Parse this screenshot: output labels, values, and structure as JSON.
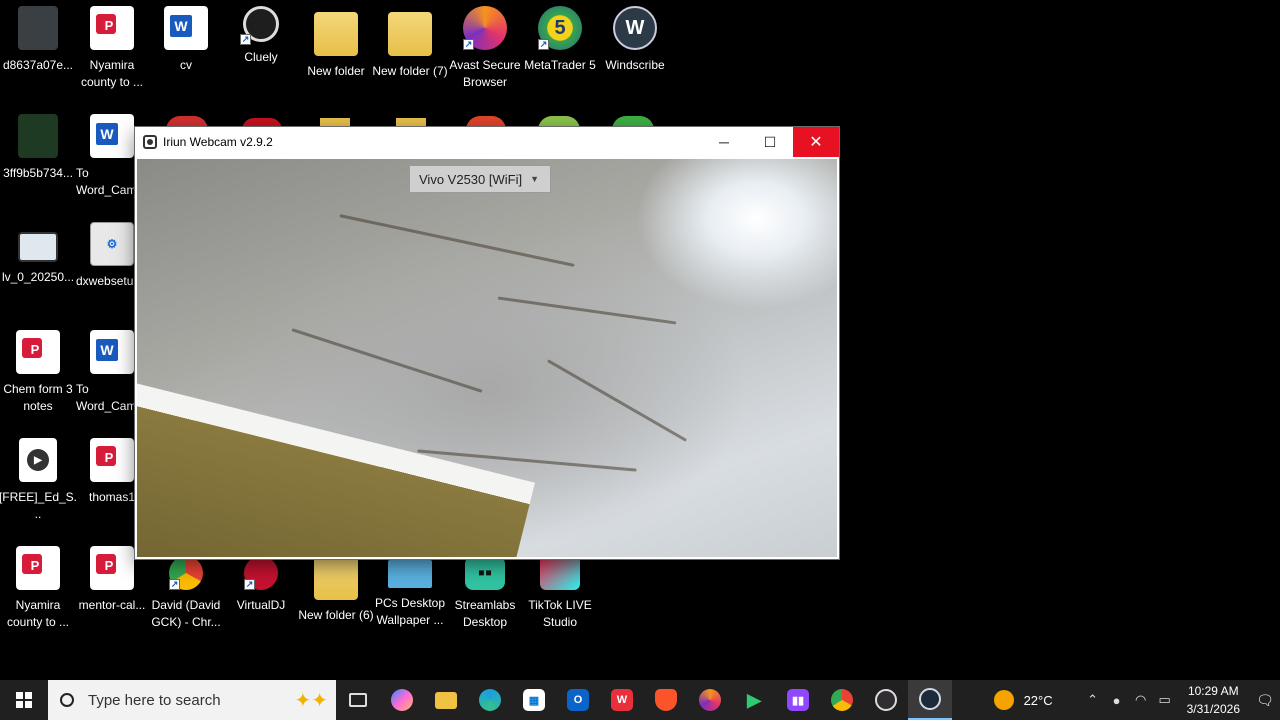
{
  "desktop": {
    "icons": [
      {
        "label": "d8637a07e...",
        "kind": "image"
      },
      {
        "label": "Nyamira county to ...",
        "kind": "pdf"
      },
      {
        "label": "cv",
        "kind": "word"
      },
      {
        "label": "Cluely",
        "kind": "app"
      },
      {
        "label": "New folder",
        "kind": "folder"
      },
      {
        "label": "New folder (7)",
        "kind": "folder"
      },
      {
        "label": "Avast Secure Browser",
        "kind": "app"
      },
      {
        "label": "MetaTrader 5",
        "kind": "app"
      },
      {
        "label": "Windscribe",
        "kind": "app"
      },
      {
        "label": "3ff9b5b734...",
        "kind": "image"
      },
      {
        "label": "To Word_Cam",
        "kind": "word"
      },
      {
        "label": "lv_0_20250...",
        "kind": "video"
      },
      {
        "label": "dxwebsetu",
        "kind": "app"
      },
      {
        "label": "Chem form 3 notes",
        "kind": "pdf"
      },
      {
        "label": "To Word_Cam",
        "kind": "word"
      },
      {
        "label": "[FREE]_Ed_S...",
        "kind": "audio"
      },
      {
        "label": "thomas1",
        "kind": "pdf"
      },
      {
        "label": "Nyamira county to ...",
        "kind": "pdf"
      },
      {
        "label": "mentor-cal...",
        "kind": "pdf"
      },
      {
        "label": "David (David GCK) - Chr...",
        "kind": "app"
      },
      {
        "label": "VirtualDJ",
        "kind": "app"
      },
      {
        "label": "New folder (6)",
        "kind": "folder"
      },
      {
        "label": "PCs Desktop Wallpaper ...",
        "kind": "app"
      },
      {
        "label": "Streamlabs Desktop",
        "kind": "app"
      },
      {
        "label": "TikTok LIVE Studio",
        "kind": "app"
      }
    ]
  },
  "window": {
    "title": "Iriun Webcam v2.9.2",
    "device_select": "Vivo V2530 [WiFi]",
    "controls": {
      "minimize": "─",
      "maximize": "☐",
      "close": "✕"
    }
  },
  "taskbar": {
    "search_placeholder": "Type here to search",
    "apps": [
      "task-view",
      "copilot",
      "file-explorer",
      "edge",
      "store",
      "outlook",
      "wps",
      "brave",
      "avast",
      "xbox",
      "twitch",
      "chrome",
      "obs",
      "iriun"
    ],
    "weather": "22°C",
    "time": "10:29 AM",
    "date": "3/31/2026"
  },
  "colors": {
    "close_red": "#e81123",
    "taskbar": "#202020",
    "search_bg": "#f2f2f2"
  }
}
